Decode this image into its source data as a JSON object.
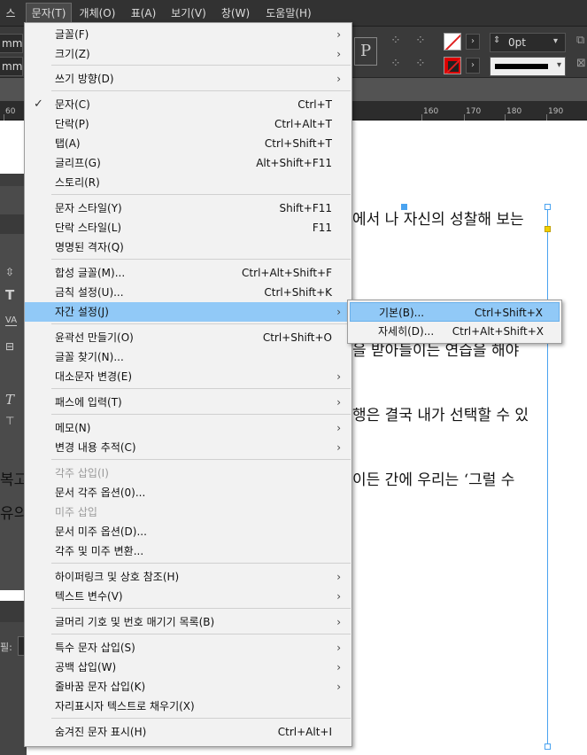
{
  "menubar": {
    "items": [
      "스(L)",
      "문자(T)",
      "개체(O)",
      "표(A)",
      "보기(V)",
      "창(W)",
      "도움말(H)"
    ]
  },
  "controlbar": {
    "field1": "mm",
    "field2": "mm",
    "stroke_value": "0pt",
    "p_icon": "P"
  },
  "ruler": {
    "labels": [
      "60",
      "160",
      "170",
      "180",
      "190"
    ]
  },
  "document": {
    "lines": [
      "에서 나 자신의 성찰해 보는",
      "을 받아들이는 연습을 해야",
      "행은 결국 내가 선택할 수 있",
      "이든 간에 우리는 ‘그럴 수"
    ],
    "left_fragments": [
      "복고",
      "유의"
    ]
  },
  "menu": {
    "items": [
      {
        "label": "글꼴(F)",
        "shortcut": "",
        "submenu": true
      },
      {
        "label": "크기(Z)",
        "shortcut": "",
        "submenu": true
      },
      {
        "label": "쓰기 방향(D)",
        "shortcut": "",
        "submenu": true
      },
      {
        "label": "문자(C)",
        "shortcut": "Ctrl+T",
        "checked": true
      },
      {
        "label": "단락(P)",
        "shortcut": "Ctrl+Alt+T"
      },
      {
        "label": "탭(A)",
        "shortcut": "Ctrl+Shift+T"
      },
      {
        "label": "글리프(G)",
        "shortcut": "Alt+Shift+F11"
      },
      {
        "label": "스토리(R)",
        "shortcut": ""
      },
      {
        "label": "문자 스타일(Y)",
        "shortcut": "Shift+F11"
      },
      {
        "label": "단락 스타일(L)",
        "shortcut": "F11"
      },
      {
        "label": "명명된 격자(Q)",
        "shortcut": ""
      },
      {
        "label": "합성 글꼴(M)...",
        "shortcut": "Ctrl+Alt+Shift+F"
      },
      {
        "label": "금칙 설정(U)...",
        "shortcut": "Ctrl+Shift+K"
      },
      {
        "label": "자간 설정(J)",
        "shortcut": "",
        "submenu": true,
        "highlighted": true
      },
      {
        "label": "윤곽선 만들기(O)",
        "shortcut": "Ctrl+Shift+O"
      },
      {
        "label": "글꼴 찾기(N)...",
        "shortcut": ""
      },
      {
        "label": "대소문자 변경(E)",
        "shortcut": "",
        "submenu": true
      },
      {
        "label": "패스에 입력(T)",
        "shortcut": "",
        "submenu": true
      },
      {
        "label": "메모(N)",
        "shortcut": "",
        "submenu": true
      },
      {
        "label": "변경 내용 추적(C)",
        "shortcut": "",
        "submenu": true
      },
      {
        "label": "각주 삽입(I)",
        "shortcut": "",
        "disabled": true
      },
      {
        "label": "문서 각주 옵션(0)...",
        "shortcut": ""
      },
      {
        "label": "미주 삽입",
        "shortcut": "",
        "disabled": true
      },
      {
        "label": "문서 미주 옵션(D)...",
        "shortcut": ""
      },
      {
        "label": "각주 및 미주 변환...",
        "shortcut": ""
      },
      {
        "label": "하이퍼링크 및 상호 참조(H)",
        "shortcut": "",
        "submenu": true
      },
      {
        "label": "텍스트 변수(V)",
        "shortcut": "",
        "submenu": true
      },
      {
        "label": "글머리 기호 및 번호 매기기 목록(B)",
        "shortcut": "",
        "submenu": true
      },
      {
        "label": "특수 문자 삽입(S)",
        "shortcut": "",
        "submenu": true
      },
      {
        "label": "공백 삽입(W)",
        "shortcut": "",
        "submenu": true
      },
      {
        "label": "줄바꿈 문자 삽입(K)",
        "shortcut": "",
        "submenu": true
      },
      {
        "label": "자리표시자 텍스트로 채우기(X)",
        "shortcut": ""
      },
      {
        "label": "숨겨진 문자 표시(H)",
        "shortcut": "Ctrl+Alt+I"
      }
    ]
  },
  "submenu": {
    "items": [
      {
        "label": "기본(B)...",
        "shortcut": "Ctrl+Shift+X",
        "highlighted": true
      },
      {
        "label": "자세히(D)...",
        "shortcut": "Ctrl+Alt+Shift+X"
      }
    ]
  },
  "panel_fragment": "필:"
}
